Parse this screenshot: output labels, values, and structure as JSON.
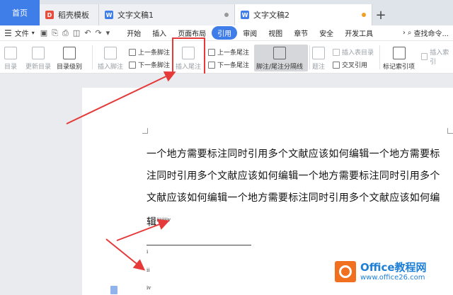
{
  "tabs": {
    "home": "首页",
    "template": "稻壳模板",
    "doc1": "文字文稿1",
    "doc2": "文字文稿2",
    "new_tab": "+"
  },
  "menu": {
    "file": "文件",
    "items": [
      "开始",
      "插入",
      "页面布局",
      "引用",
      "审阅",
      "视图",
      "章节",
      "安全",
      "开发工具"
    ],
    "search": "查找命令..."
  },
  "ribbon": {
    "toc": "目录",
    "update_toc": "更新目录",
    "toc_level": "目录级别",
    "insert_footnote": "插入脚注",
    "prev_footnote": "上一条脚注",
    "next_footnote": "下一条脚注",
    "insert_endnote": "插入尾注",
    "prev_endnote": "上一条尾注",
    "next_endnote": "下一条尾注",
    "separator": "脚注/尾注分隔线",
    "caption": "题注",
    "insert_table_fig": "插入表目录",
    "cross_ref": "交叉引用",
    "mark_index": "标记索引项",
    "insert_index": "插入索引"
  },
  "document": {
    "paragraph": "一个地方需要标注同时引用多个文献应该如何编辑一个地方需要标注同时引用多个文献应该如何编辑一个地方需要标注同时引用多个文献应该如何编辑一个地方需要标注同时引用多个文献应该如何编辑",
    "superscripts": "iiiiiiiv",
    "footnotes": [
      "i",
      "ii",
      "iv"
    ]
  },
  "watermark": {
    "brand": "Office教程网",
    "url": "www.office26.com"
  },
  "colors": {
    "accent": "#3f7de8",
    "highlight_box": "#e63a3a",
    "arrow": "#e63a3a",
    "logo_orange": "#f07020",
    "logo_blue": "#1d7fd6"
  }
}
